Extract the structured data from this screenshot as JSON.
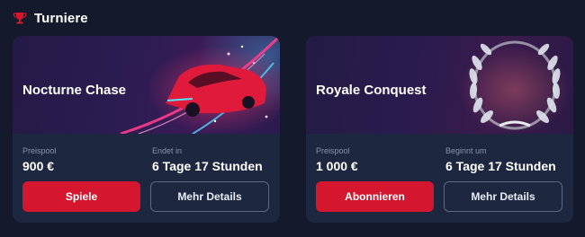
{
  "section": {
    "title": "Turniere",
    "icon": "trophy-icon",
    "accent_color": "#d4162f"
  },
  "tournaments": [
    {
      "name": "Nocturne Chase",
      "banner_art": "neon-sports-car",
      "prize_label": "Preispool",
      "prize_value": "900 €",
      "time_label": "Endet in",
      "time_value": "6 Tage 17 Stunden",
      "primary_button": "Spiele",
      "secondary_button": "Mehr Details"
    },
    {
      "name": "Royale Conquest",
      "banner_art": "silver-laurel-wreath",
      "prize_label": "Preispool",
      "prize_value": "1 000 €",
      "time_label": "Beginnt um",
      "time_value": "6 Tage 17 Stunden",
      "primary_button": "Abonnieren",
      "secondary_button": "Mehr Details"
    }
  ]
}
